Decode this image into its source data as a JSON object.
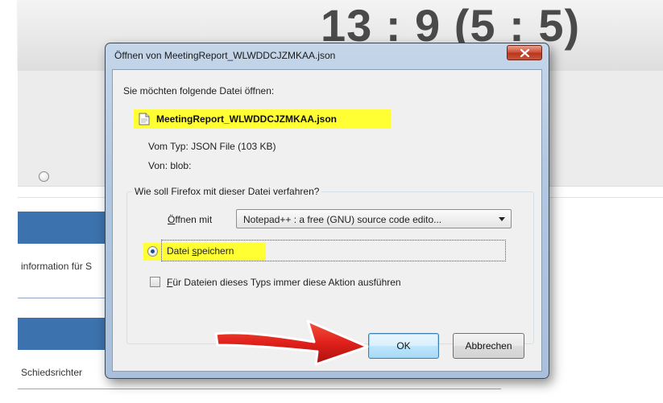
{
  "background": {
    "score": "13 : 9 (5 : 5)",
    "panel1_text": "information für S",
    "panel2_text": "Schiedsrichter"
  },
  "dialog": {
    "title": "Öffnen von MeetingReport_WLWDDCJZMKAA.json",
    "question": "Sie möchten folgende Datei öffnen:",
    "file_name": "MeetingReport_WLWDDCJZMKAA.json",
    "type_label": "Vom Typ:",
    "type_value": "JSON File (103 KB)",
    "from_label": "Von:",
    "from_value": "blob:",
    "group_title": "Wie soll Firefox mit dieser Datei verfahren?",
    "open_with_prefix": "Ö",
    "open_with_rest": "ffnen mit",
    "open_with_app": "Notepad++ : a free (GNU) source code edito...",
    "save_prefix": "Datei ",
    "save_underlined": "s",
    "save_rest": "peichern",
    "always_prefix": "F",
    "always_rest": "ür Dateien dieses Typs immer diese Aktion ausführen",
    "ok_label": "OK",
    "cancel_label": "Abbrechen",
    "selected_option": "Datei speichern",
    "always_checked": false
  },
  "colors": {
    "highlight": "#ffff33",
    "arrow": "#e0201b",
    "panel_blue": "#3c72ad",
    "close_red": "#c9452c"
  },
  "icons": {
    "close": "close-x-icon",
    "file": "file-document-icon",
    "dropdown": "chevron-down-icon",
    "annotation": "red-arrow-icon"
  }
}
